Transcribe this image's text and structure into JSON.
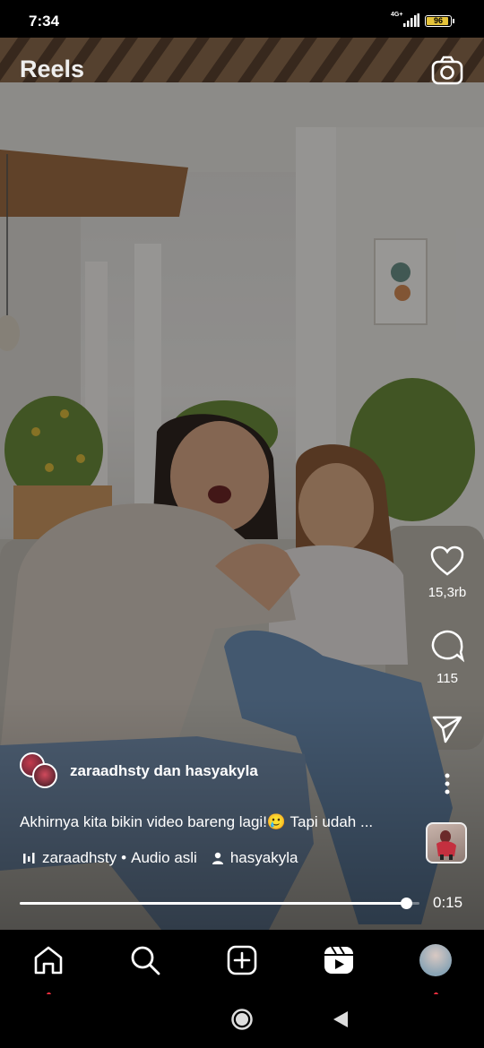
{
  "status": {
    "time": "7:34",
    "network": "4G+",
    "battery": "96",
    "battery_level": 0.96
  },
  "header": {
    "title": "Reels",
    "camera_icon": "camera-icon"
  },
  "actions": {
    "like": {
      "icon": "heart-icon",
      "count": "15,3rb"
    },
    "comment": {
      "icon": "comment-icon",
      "count": "115"
    },
    "share": {
      "icon": "send-icon"
    },
    "more": {
      "icon": "more-vertical-icon"
    }
  },
  "post": {
    "authors": "zaraadhsty dan hasyakyla",
    "caption": "Akhirnya kita bikin video bareng lagi!🥲 Tapi udah ...",
    "audio_author": "zaraadhsty",
    "separator": "•",
    "audio_label": "Audio asli",
    "tagged_user": "hasyakyla"
  },
  "playback": {
    "progress": 0.967,
    "duration": "0:15"
  },
  "tabs": [
    {
      "name": "home",
      "icon": "home-icon",
      "active": true
    },
    {
      "name": "search",
      "icon": "search-icon"
    },
    {
      "name": "create",
      "icon": "add-square-icon"
    },
    {
      "name": "reels",
      "icon": "reels-icon"
    },
    {
      "name": "profile",
      "icon": "profile-avatar"
    }
  ],
  "system_nav": {
    "home": "circle-home-icon",
    "back": "triangle-back-icon"
  },
  "colors": {
    "notification_dot": "#ff3040",
    "battery": "#e5c33a",
    "background": "#000000"
  }
}
